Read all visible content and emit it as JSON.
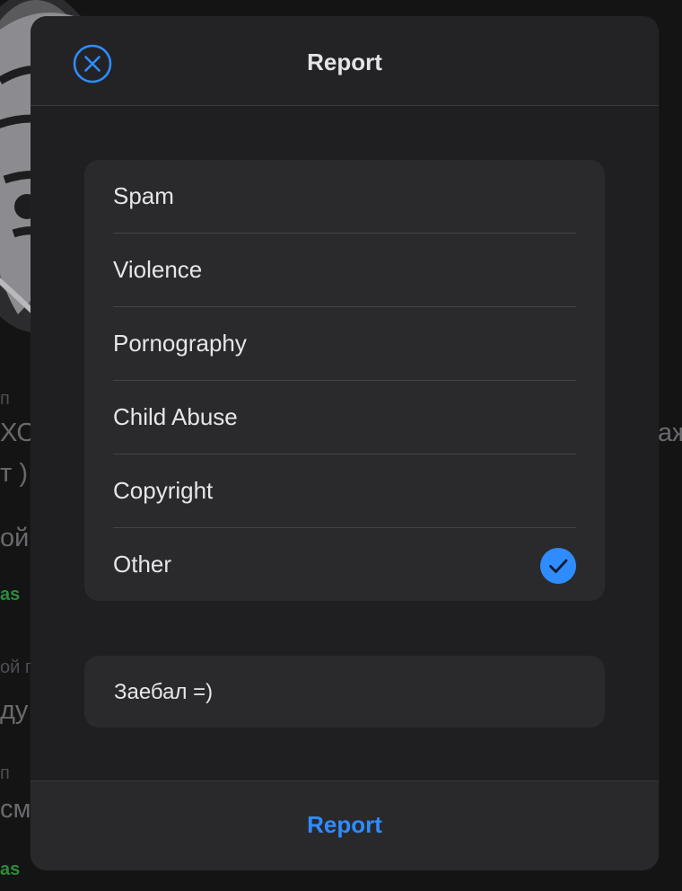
{
  "background": {
    "fragments": [
      {
        "text": "п",
        "cls": "sm dim"
      },
      {
        "text": "ХО",
        "cls": "lg"
      },
      {
        "text": "т )",
        "cls": "lg"
      },
      {
        "text": "ой",
        "cls": "lg"
      },
      {
        "text": "as",
        "cls": "sm green"
      },
      {
        "text": "ой п",
        "cls": "sm dim"
      },
      {
        "text": "ду",
        "cls": "lg"
      },
      {
        "text": "п",
        "cls": "sm dim"
      },
      {
        "text": "см",
        "cls": "lg"
      },
      {
        "text": "as",
        "cls": "sm green"
      },
      {
        "text": "аж",
        "cls": "lg"
      }
    ]
  },
  "modal": {
    "title": "Report",
    "close_icon": "close-circle-icon",
    "options": [
      {
        "label": "Spam",
        "selected": false
      },
      {
        "label": "Violence",
        "selected": false
      },
      {
        "label": "Pornography",
        "selected": false
      },
      {
        "label": "Child Abuse",
        "selected": false
      },
      {
        "label": "Copyright",
        "selected": false
      },
      {
        "label": "Other",
        "selected": true
      }
    ],
    "check_icon": "checkmark-circle-icon",
    "comment": {
      "value": "Заебал =)"
    },
    "submit_label": "Report"
  },
  "colors": {
    "accent": "#2f8cff",
    "modal_bg": "#1f1f21",
    "card_bg": "#2a2a2c",
    "text": "#e6e6e8",
    "green_text": "#2e8b3a"
  }
}
